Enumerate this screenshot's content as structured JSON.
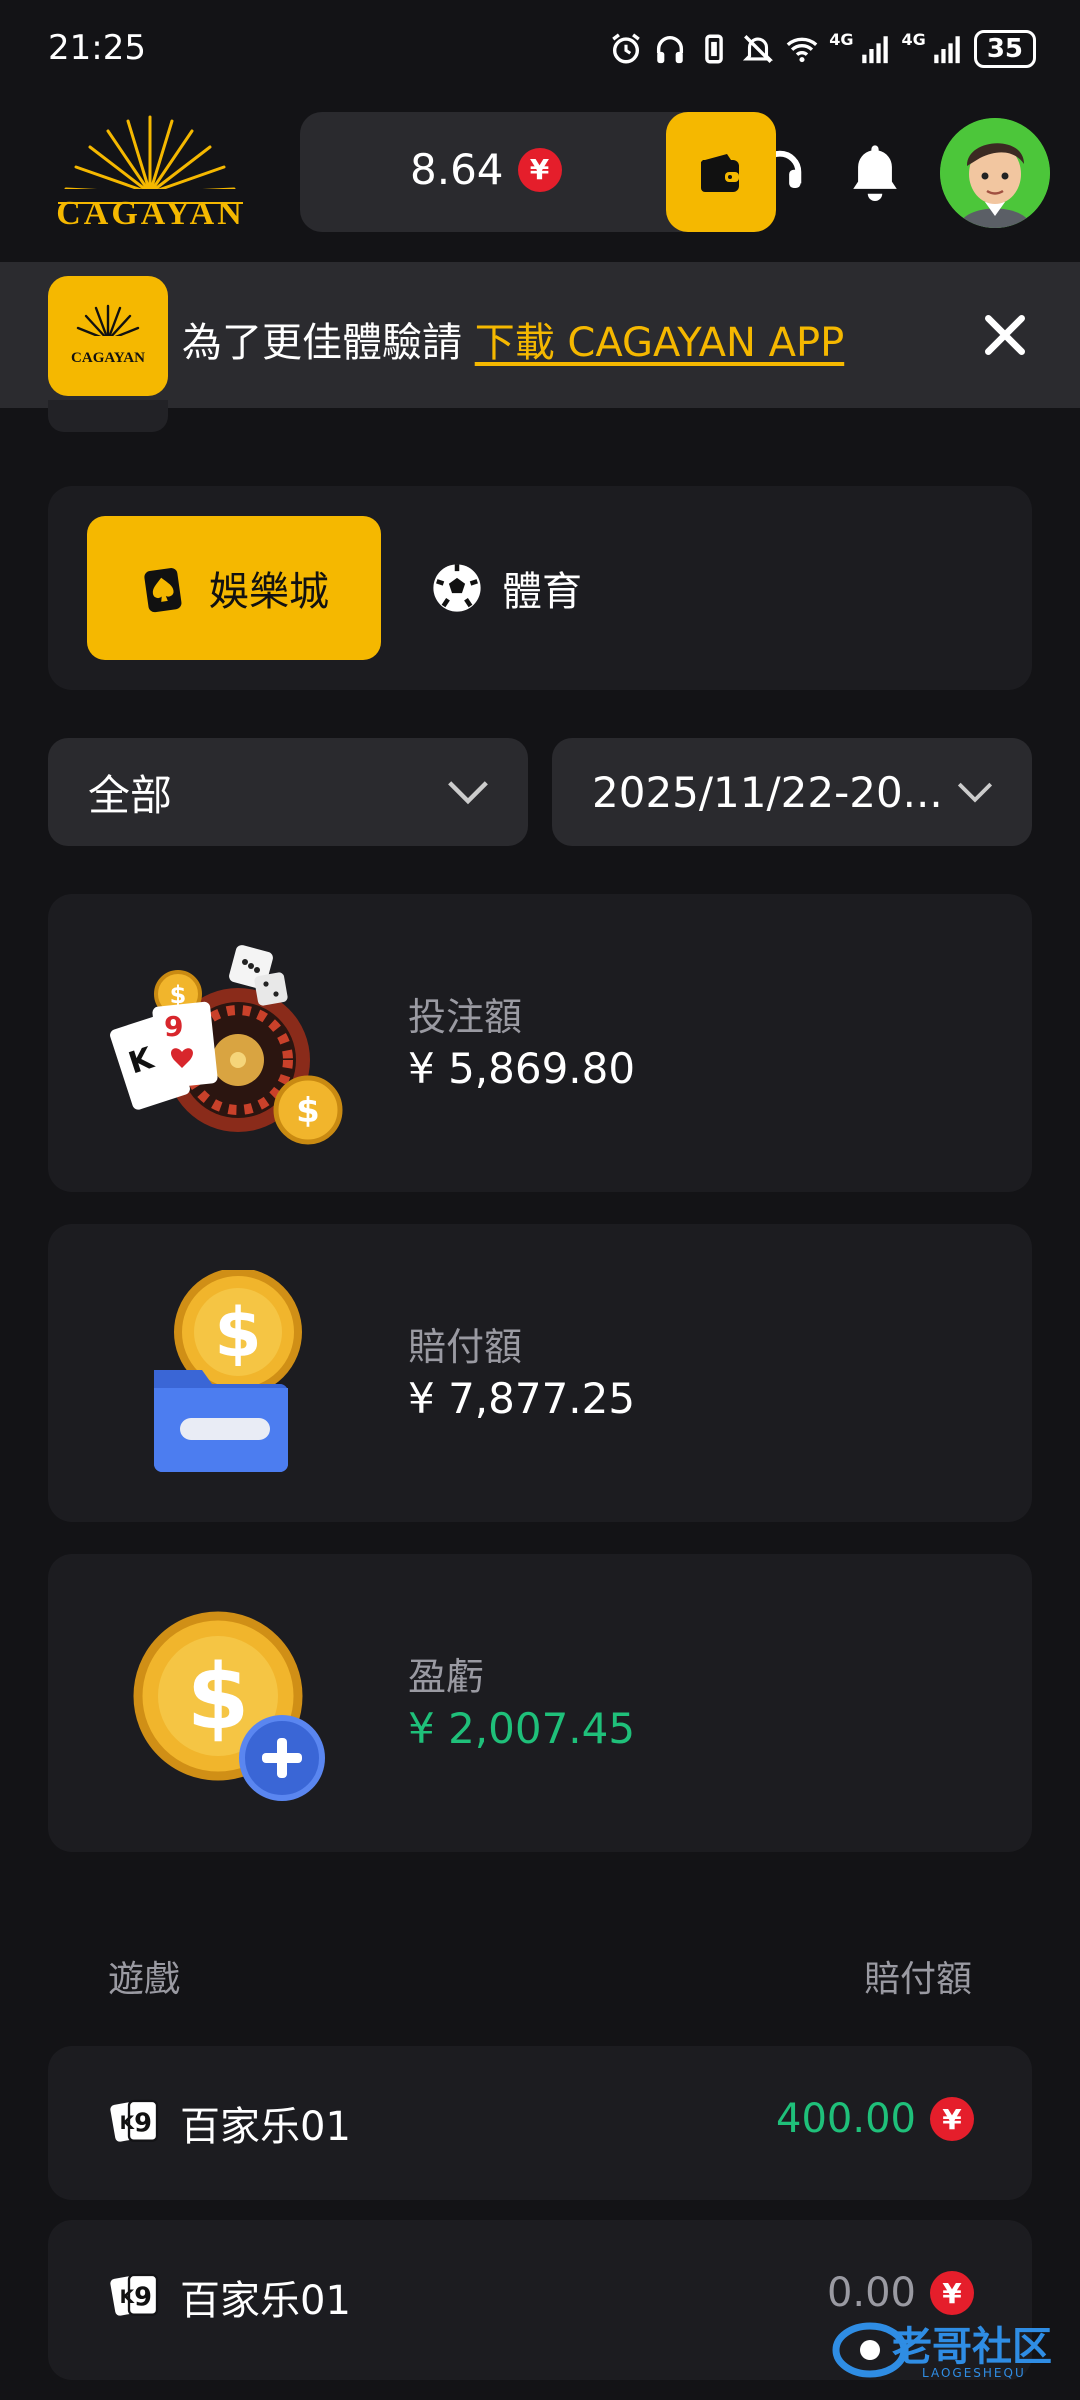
{
  "status_bar": {
    "time": "21:25",
    "battery": "35",
    "network_1": "4G",
    "network_2": "4G"
  },
  "header": {
    "logo_text": "CAGAYAN",
    "balance": "8.64",
    "currency_symbol": "¥"
  },
  "banner": {
    "app_icon_text": "CAGAYAN",
    "message": "為了更佳體驗請 ",
    "link_text": "下載 CAGAYAN APP"
  },
  "tabs": [
    {
      "label": "娛樂城",
      "active": true,
      "icon": "spade-card-icon"
    },
    {
      "label": "體育",
      "active": false,
      "icon": "soccer-ball-icon"
    }
  ],
  "filters": {
    "type_value": "全部",
    "date_value": "2025/11/22-20..."
  },
  "stats": [
    {
      "label": "投注額",
      "value": "¥ 5,869.80",
      "icon": "casino-roulette-icon"
    },
    {
      "label": "賠付額",
      "value": "¥ 7,877.25",
      "icon": "coin-wallet-minus-icon"
    },
    {
      "label": "盈虧",
      "value": "¥ 2,007.45",
      "icon": "coin-plus-icon"
    }
  ],
  "list": {
    "col_game": "遊戲",
    "col_payout": "賠付額",
    "rows": [
      {
        "name": "百家乐01",
        "amount": "400.00",
        "color": "#1fc07a"
      },
      {
        "name": "百家乐01",
        "amount": "0.00",
        "color": "#9a9aa2"
      }
    ]
  },
  "watermark": {
    "text": "老哥社区",
    "subtext": "LAOGESHEQU"
  },
  "colors": {
    "accent": "#f5b800",
    "background": "#131316",
    "card": "#1c1c20",
    "positive": "#1fc07a",
    "yen_badge": "#e51e2b"
  }
}
